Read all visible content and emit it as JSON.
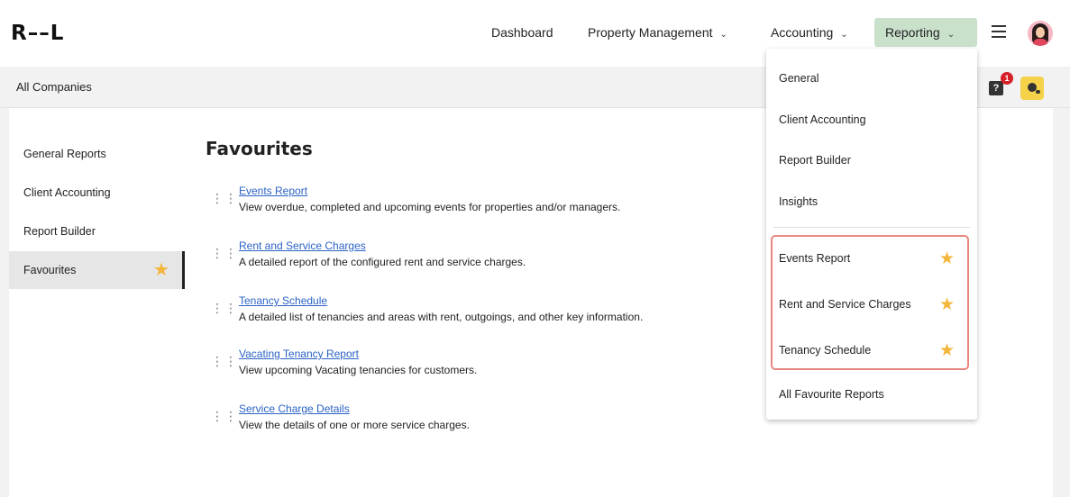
{
  "logo": "R––L",
  "nav": {
    "dashboard": "Dashboard",
    "property": "Property Management",
    "accounting": "Accounting",
    "reporting": "Reporting"
  },
  "subbar": {
    "title": "All Companies",
    "help_badge": "1"
  },
  "sidebar": {
    "items": [
      {
        "label": "General Reports"
      },
      {
        "label": "Client Accounting"
      },
      {
        "label": "Report Builder"
      },
      {
        "label": "Favourites"
      }
    ]
  },
  "favourites": {
    "title": "Favourites",
    "reports": [
      {
        "name": "Events Report",
        "desc": "View overdue, completed and upcoming events for properties and/or managers."
      },
      {
        "name": "Rent and Service Charges",
        "desc": "A detailed report of the configured rent and service charges."
      },
      {
        "name": "Tenancy Schedule",
        "desc": "A detailed list of tenancies and areas with rent, outgoings, and other key information."
      },
      {
        "name": "Vacating Tenancy Report",
        "desc": "View upcoming Vacating tenancies for customers."
      },
      {
        "name": "Service Charge Details",
        "desc": "View the details of one or more service charges."
      }
    ]
  },
  "dropdown": {
    "items": [
      "General",
      "Client Accounting",
      "Report Builder",
      "Insights"
    ],
    "favourites": [
      "Events Report",
      "Rent and Service Charges",
      "Tenancy Schedule"
    ],
    "all_favourites": "All Favourite Reports"
  },
  "colors": {
    "reporting_active": "#c9e0cb",
    "star": "#f4b63a",
    "link": "#2b62c4",
    "highlight_border": "#e8877f"
  }
}
